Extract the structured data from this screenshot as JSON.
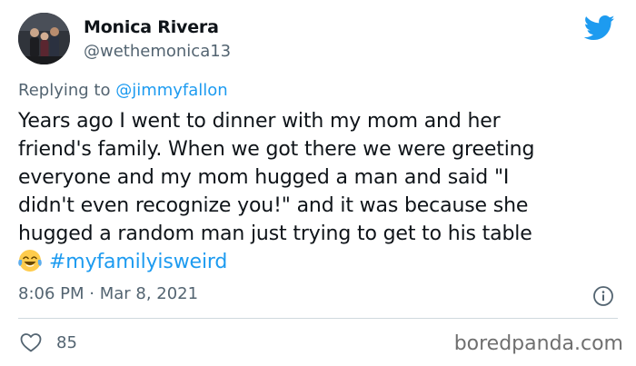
{
  "author": {
    "name": "Monica Rivera",
    "handle": "@wethemonica13",
    "avatar_icon": "profile-photo"
  },
  "reply": {
    "prefix": "Replying to ",
    "to_handle": "@jimmyfallon"
  },
  "tweet": {
    "lines": [
      "Years ago I went to dinner with my mom and her",
      "friend's family. When we got there we were greeting",
      "everyone and my mom hugged a man and said \"I",
      "didn't even recognize you!\" and it was because she",
      "hugged a random man just trying to get to his table"
    ],
    "emoji_icon": "face-with-tears-of-joy",
    "hashtag": "#myfamilyisweird"
  },
  "meta": {
    "time": "8:06 PM",
    "separator": " · ",
    "date": "Mar 8, 2021"
  },
  "stats": {
    "likes": "85"
  },
  "watermark": "boredpanda.com",
  "colors": {
    "text": "#0f1419",
    "secondary": "#536471",
    "accent": "#1d9bf0"
  }
}
